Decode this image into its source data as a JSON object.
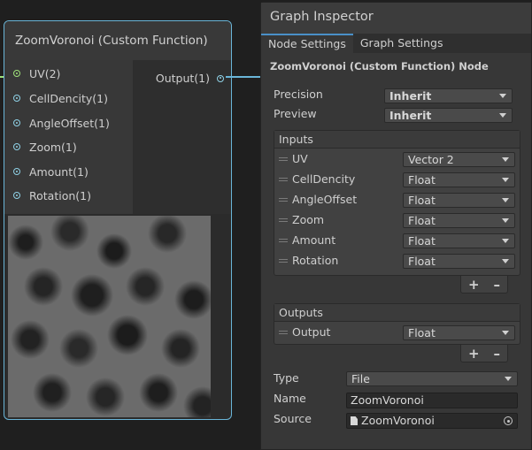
{
  "node": {
    "title": "ZoomVoronoi (Custom Function)",
    "inputs": [
      "UV(2)",
      "CellDencity(1)",
      "AngleOffset(1)",
      "Zoom(1)",
      "Amount(1)",
      "Rotation(1)"
    ],
    "output": "Output(1)"
  },
  "inspector": {
    "title": "Graph Inspector",
    "tabs": [
      "Node Settings",
      "Graph Settings"
    ],
    "subtitle": "ZoomVoronoi (Custom Function) Node",
    "precision_label": "Precision",
    "precision_value": "Inherit",
    "preview_label": "Preview",
    "preview_value": "Inherit",
    "inputs_header": "Inputs",
    "inputs": [
      {
        "name": "UV",
        "type": "Vector 2"
      },
      {
        "name": "CellDencity",
        "type": "Float"
      },
      {
        "name": "AngleOffset",
        "type": "Float"
      },
      {
        "name": "Zoom",
        "type": "Float"
      },
      {
        "name": "Amount",
        "type": "Float"
      },
      {
        "name": "Rotation",
        "type": "Float"
      }
    ],
    "outputs_header": "Outputs",
    "outputs": [
      {
        "name": "Output",
        "type": "Float"
      }
    ],
    "add_symbol": "+",
    "remove_symbol": "–",
    "type_label": "Type",
    "type_value": "File",
    "name_label": "Name",
    "name_value": "ZoomVoronoi",
    "source_label": "Source",
    "source_value": "ZoomVoronoi"
  },
  "colors": {
    "node_border": "#6ab5d8",
    "uv_port": "#9fe27a",
    "port": "#8fd1e6",
    "tab_accent": "#4a90c8"
  }
}
